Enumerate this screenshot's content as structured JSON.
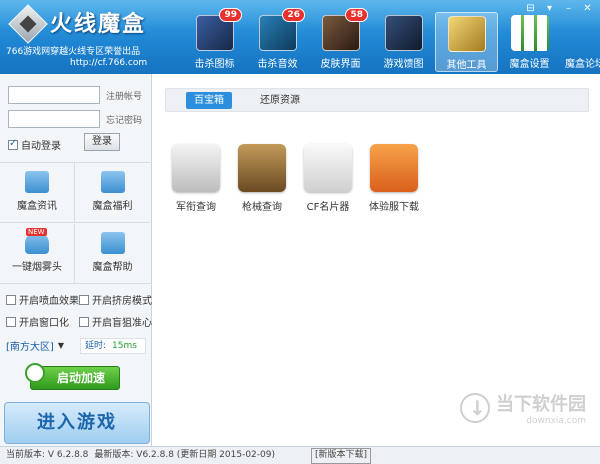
{
  "app": {
    "title": "火线魔盒",
    "subtitle": "766游戏网穿越火线专区荣誉出品",
    "url": "http://cf.766.com"
  },
  "window_controls": [
    "⊟",
    "▾",
    "–",
    "✕"
  ],
  "nav": [
    {
      "label": "击杀图标",
      "badge": "99",
      "icon": "skull-shield-icon",
      "color": "#243c6b"
    },
    {
      "label": "击杀音效",
      "badge": "26",
      "icon": "audio-wave-icon",
      "color": "#1e5a86"
    },
    {
      "label": "皮肤界面",
      "badge": "58",
      "icon": "character-icon",
      "color": "#4a3326"
    },
    {
      "label": "游戏馈图",
      "badge": "",
      "icon": "map-icon",
      "color": "#1d2e48"
    },
    {
      "label": "其他工具",
      "badge": "",
      "icon": "tools-icon",
      "color": "#c9a53a",
      "active": true
    },
    {
      "label": "魔盒设置",
      "badge": "",
      "icon": "settings-grid-icon",
      "color": "#3a8f3a"
    },
    {
      "label": "魔盒论坛",
      "badge": "",
      "icon": "forum-icon",
      "color": "#ffffff"
    }
  ],
  "login": {
    "account_label": "注册帐号",
    "password_label": "忘记密码",
    "auto_login_label": "自动登录",
    "auto_login_checked": true,
    "login_button": "登录"
  },
  "left_grid": [
    {
      "label": "魔盒资讯",
      "icon": "book-icon",
      "color": "#4a9ad8"
    },
    {
      "label": "魔盒福利",
      "icon": "gift-icon",
      "color": "#4a9ad8"
    },
    {
      "label": "一键烟雾头",
      "icon": "helmet-icon",
      "color": "#4a9ad8",
      "tag": "NEW"
    },
    {
      "label": "魔盒帮助",
      "icon": "hand-icon",
      "color": "#4a9ad8"
    }
  ],
  "options": [
    {
      "label": "开启喷血效果",
      "checked": false
    },
    {
      "label": "开启挤房模式",
      "checked": false
    },
    {
      "label": "开启窗口化",
      "checked": false
    },
    {
      "label": "开启盲狙准心",
      "checked": false
    }
  ],
  "region": {
    "label": "[南方大区]",
    "latency_label": "延时:",
    "latency_value": "15ms"
  },
  "accelerate_button": "启动加速",
  "enter_game_button": "进入游戏",
  "tabs": [
    {
      "label": "百宝箱",
      "active": true
    },
    {
      "label": "还原资源",
      "active": false
    }
  ],
  "tools": [
    {
      "label": "军衔查询",
      "icon": "medal-icon",
      "color": "#c9c9c9"
    },
    {
      "label": "枪械查询",
      "icon": "revolver-icon",
      "color": "#8b6a3a"
    },
    {
      "label": "CF名片器",
      "icon": "dog-tag-icon",
      "color": "#e6e6e6"
    },
    {
      "label": "体验服下载",
      "icon": "question-icon",
      "color": "#e8822c"
    }
  ],
  "watermark": {
    "title": "当下软件园",
    "url": "downxia.com"
  },
  "status": {
    "current_version": "当前版本: V 6.2.8.8",
    "latest_version": "最新版本: V6.2.8.8 (更新日期 2015-02-09)",
    "download_link": "[新版本下载]"
  }
}
